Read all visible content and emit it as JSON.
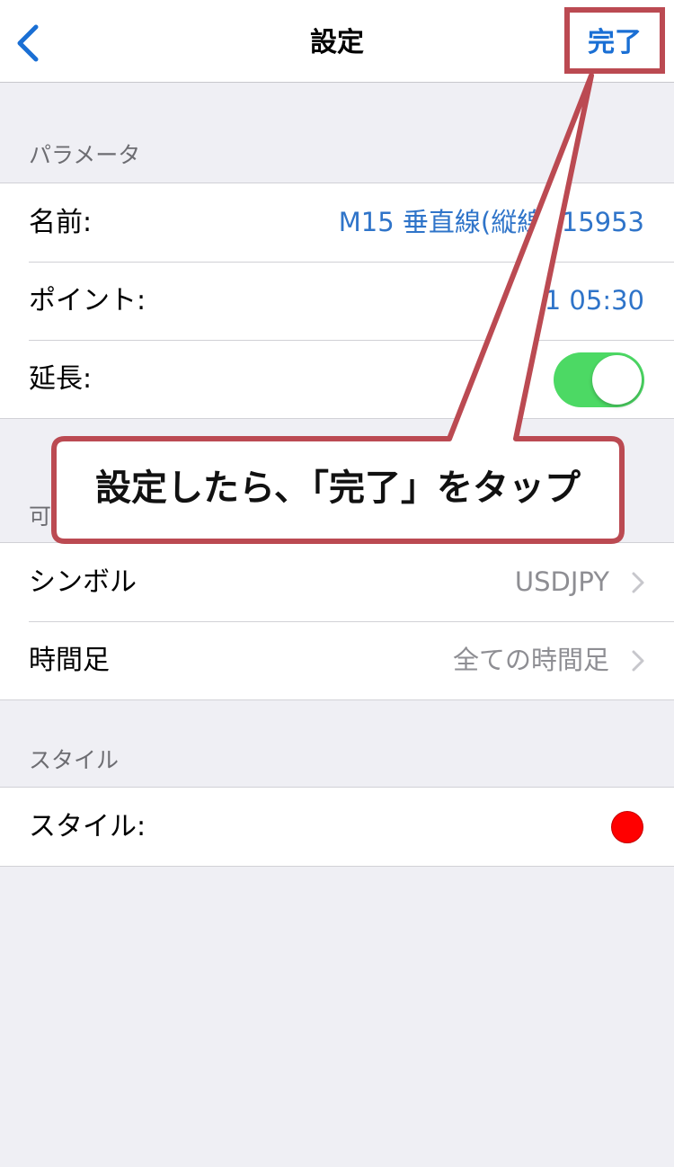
{
  "nav": {
    "title": "設定",
    "done_label": "完了"
  },
  "sections": {
    "parameters": {
      "header": "パラメータ",
      "name_label": "名前:",
      "name_value": "M15 垂直線(縦線) 15953",
      "point_label": "ポイント:",
      "point_value": "21 05:30",
      "extend_label": "延長:",
      "extend_on": true
    },
    "visibility": {
      "header": "可",
      "symbol_label": "シンボル",
      "symbol_value": "USDJPY",
      "timeframe_label": "時間足",
      "timeframe_value": "全ての時間足"
    },
    "style": {
      "header": "スタイル",
      "style_label": "スタイル:",
      "color": "#ff0000"
    }
  },
  "annotation": {
    "text": "設定したら､「完了」をタップ",
    "accent": "#bb4a52"
  },
  "colors": {
    "accent_blue": "#1a6fd4",
    "toggle_green": "#4cd964"
  }
}
